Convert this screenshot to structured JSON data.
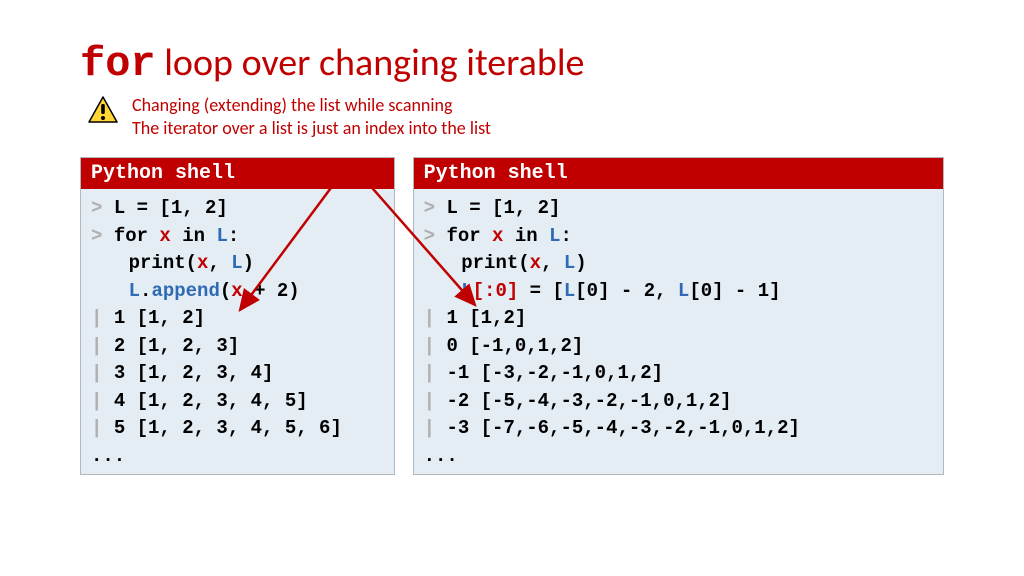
{
  "title": {
    "keyword": "for",
    "rest": " loop over changing iterable"
  },
  "warning": {
    "line1": "Changing (extending) the list while scanning",
    "line2": "The iterator over a list is just an index into the list"
  },
  "shell_label": "Python shell",
  "left": {
    "l1": "L = [1, 2]",
    "out1": "1 [1, 2]",
    "out2": "2 [1, 2, 3]",
    "out3": "3 [1, 2, 3, 4]",
    "out4": "4 [1, 2, 3, 4, 5]",
    "out5": "5 [1, 2, 3, 4, 5, 6]",
    "dots": "..."
  },
  "right": {
    "l1": "L = [1, 2]",
    "out1": "1 [1,2]",
    "out2": "0 [-1,0,1,2]",
    "out3": "-1 [-3,-2,-1,0,1,2]",
    "out4": "-2 [-5,-4,-3,-2,-1,0,1,2]",
    "out5": "-3 [-7,-6,-5,-4,-3,-2,-1,0,1,2]",
    "dots": "..."
  },
  "tok": {
    "prompt": ">",
    "bar": "|",
    "for": "for ",
    "x": "x",
    "in": " in ",
    "L": "L",
    "colon": ":",
    "print_open": "print(",
    "comma_sp": ", ",
    "close": ")",
    "dot": ".",
    "append": "append",
    "open": "(",
    "plus2": " + 2)",
    "slice": "[:0]",
    "eq": " = [",
    "idx0": "[0] - 2, ",
    "idx1": "[0] - 1]"
  }
}
